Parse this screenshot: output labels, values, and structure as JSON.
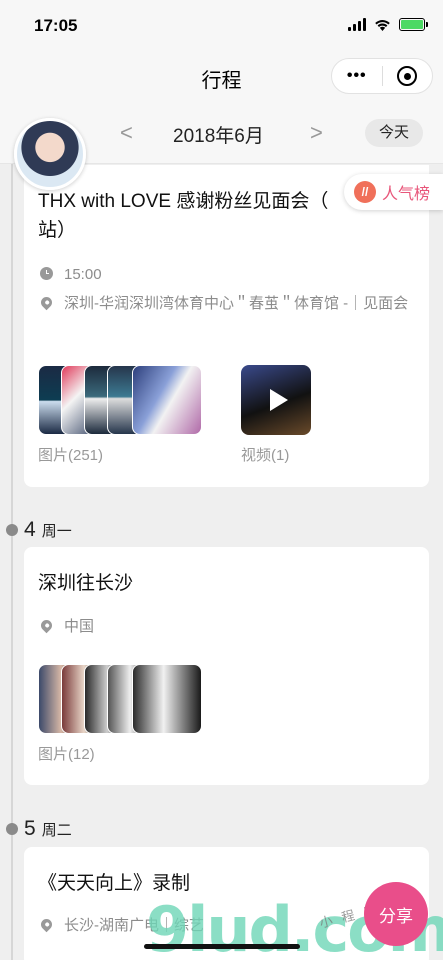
{
  "status_bar": {
    "time": "17:05"
  },
  "nav": {
    "title": "行程",
    "more_label": "•••"
  },
  "month_bar": {
    "prev": "<",
    "next": ">",
    "month": "2018年6月",
    "today": "今天"
  },
  "popular_tab": {
    "icon_text": "//",
    "label": "人气榜"
  },
  "events": [
    {
      "title": "THX with LOVE 感谢粉丝见面会（深圳站）",
      "title_visible": "THX with LOVE 感谢粉丝见面会（\n站）",
      "time": "15:00",
      "location": "深圳-华润深圳湾体育中心＂春茧＂体育馆 -｜见面会",
      "photos_label": "图片(251)",
      "video_label": "视频(1)"
    },
    {
      "day": "4",
      "weekday": "周一",
      "title": "深圳往长沙",
      "location": "中国",
      "photos_label": "图片(12)"
    },
    {
      "day": "5",
      "weekday": "周二",
      "title": "《天天向上》录制",
      "location": "长沙-湖南广电｜综艺"
    }
  ],
  "share_label": "分享",
  "watermark": {
    "main": "9lud.com",
    "sub": "小 程 序 示 例"
  },
  "colors": {
    "accent_pink": "#e94e8a",
    "popular_text": "#e8567a",
    "battery": "#4cd964"
  }
}
